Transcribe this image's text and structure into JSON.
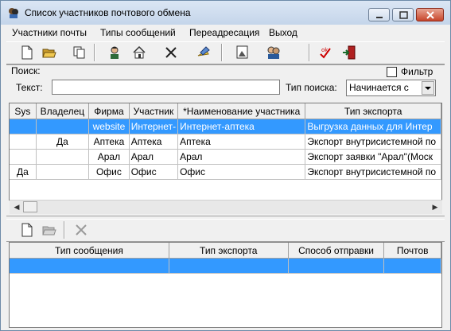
{
  "window": {
    "title": "Список участников почтового обмена"
  },
  "menu": [
    "Участники почты",
    "Типы сообщений",
    "Переадресация",
    "Выход"
  ],
  "search": {
    "legend": "Поиск:",
    "filter_label": "Фильтр",
    "text_label": "Текст:",
    "text_value": "",
    "type_label": "Тип поиска:",
    "type_value": "Начинается с"
  },
  "participants": {
    "columns": [
      "Sys",
      "Владелец",
      "Фирма",
      "Участник",
      "*Наименование участника",
      "Тип экспорта"
    ],
    "rows": [
      [
        "",
        "",
        "website",
        "Интернет-",
        "Интернет-аптека",
        "Выгрузка данных для Интер"
      ],
      [
        "",
        "Да",
        "Аптека",
        "Аптека",
        "Аптека",
        "Экспорт внутрисистемной по"
      ],
      [
        "",
        "",
        "Арал",
        "Арал",
        "Арал",
        "Экспорт заявки \"Арал\"(Моск"
      ],
      [
        "Да",
        "",
        "Офис",
        "Офис",
        "Офис",
        "Экспорт внутрисистемной по"
      ]
    ],
    "selected_row": 0
  },
  "messages": {
    "columns": [
      "Тип сообщения",
      "Тип экспорта",
      "Способ отправки",
      "Почтов"
    ],
    "rows": [
      [
        "",
        "",
        "",
        ""
      ]
    ],
    "selected_row": 0
  },
  "colors": {
    "selection": "#3399ff",
    "titlebar": "#dbe6f4",
    "close": "#c7452b"
  }
}
